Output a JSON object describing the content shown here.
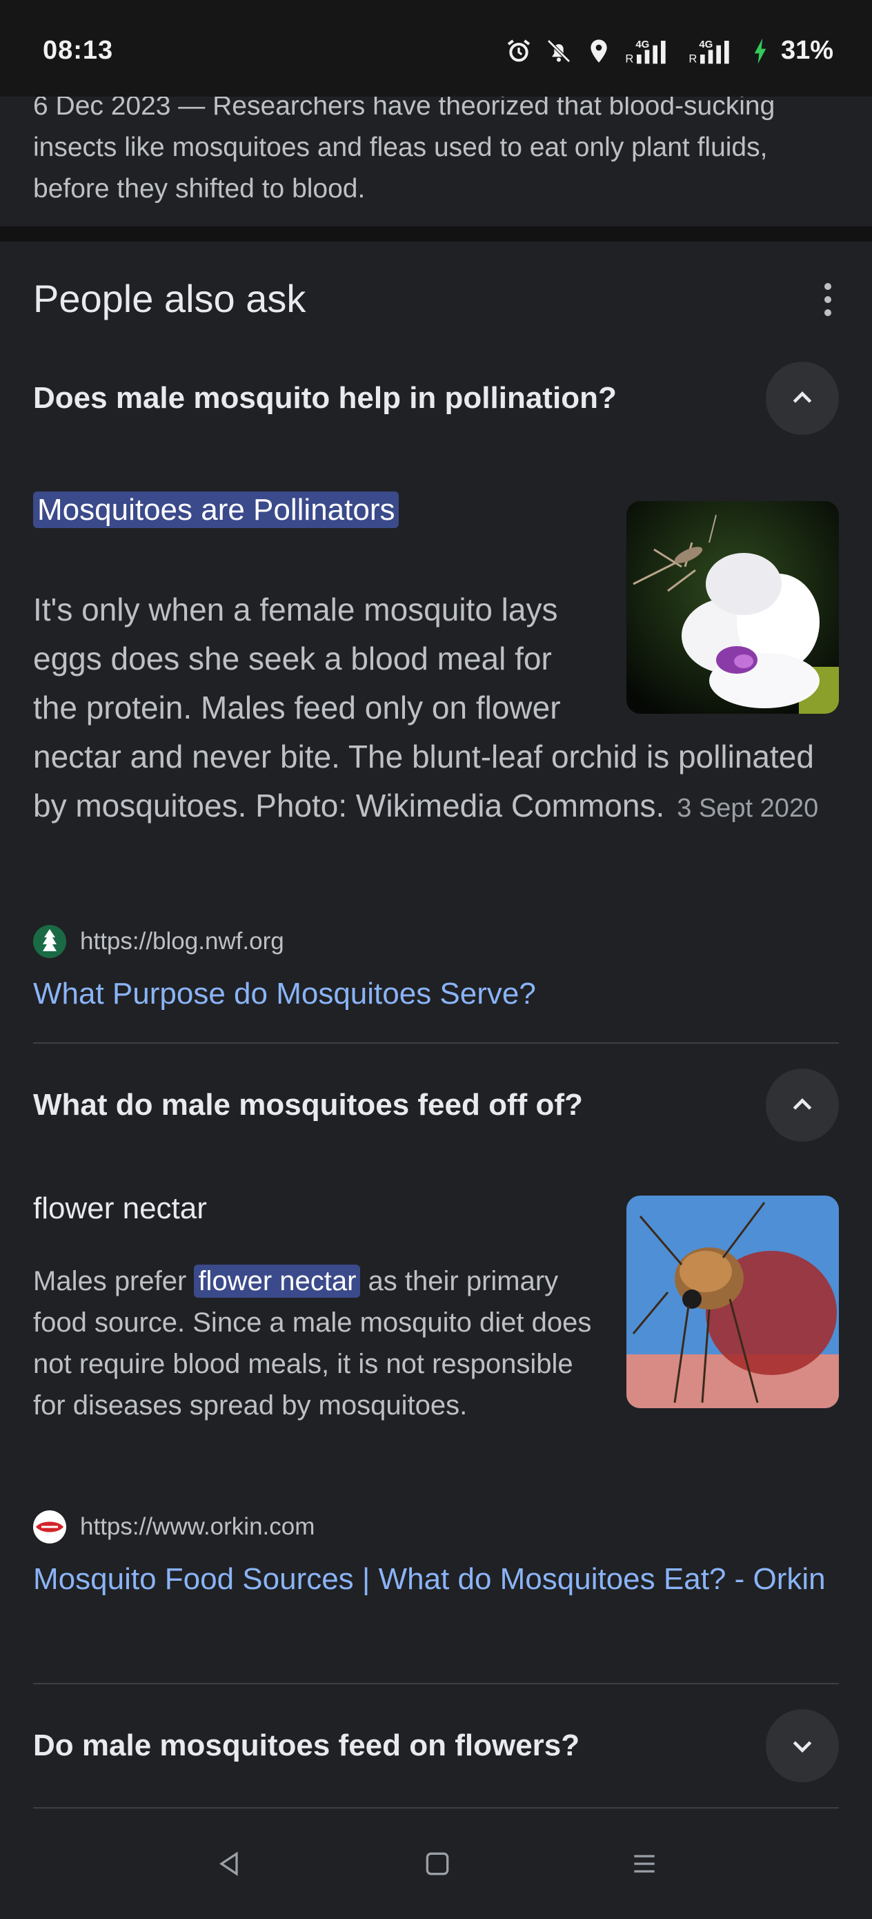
{
  "status": {
    "time": "08:13",
    "battery": "31%",
    "icons": [
      "alarm-icon",
      "bell-off-icon",
      "location-icon",
      "signal-4g-icon",
      "signal-4g-icon",
      "charging-icon"
    ],
    "net1": "4G",
    "net2": "4G",
    "roaming": "R"
  },
  "snippet": {
    "text": "6 Dec 2023 — Researchers have theorized that blood-sucking insects like mosquitoes and fleas used to eat only plant fluids, before they shifted to blood."
  },
  "paa": {
    "title": "People also ask",
    "more_icon": "more-vert-icon",
    "questions": [
      {
        "question": "Does male mosquito help in pollination?",
        "expanded": true,
        "toggle_icon": "chevron-up-icon",
        "answer_heading": "Mosquitoes are Pollinators",
        "answer_body": "It's only when a female mosquito lays eggs does she seek a blood meal for the protein. Males feed only on flower nectar and never bite. The blunt-leaf orchid is pollinated by mosquitoes. Photo: Wikimedia Commons.",
        "date": "3 Sept 2020",
        "image_alt": "mosquito on white flower",
        "source_url": "https://blog.nwf.org",
        "source_title": "What Purpose do Mosquitoes Serve?"
      },
      {
        "question": "What do male mosquitoes feed off of?",
        "expanded": true,
        "toggle_icon": "chevron-up-icon",
        "answer_heading": "flower nectar",
        "answer_body_pre": "Males prefer",
        "answer_highlight": "flower nectar",
        "answer_body_post": "as their primary food source. Since a male mosquito diet does not require blood meals, it is not responsible for diseases spread by mosquitoes.",
        "image_alt": "mosquito feeding on skin",
        "source_url": "https://www.orkin.com",
        "source_title": "Mosquito Food Sources | What do Mosquitoes Eat? - Orkin"
      },
      {
        "question": "Do male mosquitoes feed on flowers?",
        "expanded": false,
        "toggle_icon": "chevron-down-icon"
      }
    ]
  },
  "nav": {
    "back_icon": "nav-back-icon",
    "home_icon": "nav-home-icon",
    "recents_icon": "nav-recents-icon"
  },
  "colors": {
    "background": "#202124",
    "link": "#8ab4f8",
    "highlight": "#3b4a8a",
    "text": "#e8eaed",
    "muted": "#bdc1c6"
  }
}
